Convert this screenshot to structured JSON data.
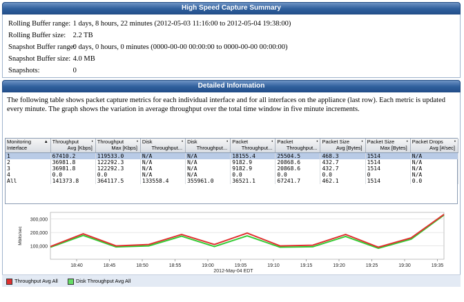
{
  "summary": {
    "title": "High Speed Capture Summary",
    "rows": [
      {
        "label": "Rolling Buffer range:",
        "value": "1 days, 8 hours, 22 minutes  (2012-05-03 11:16:00 to 2012-05-04 19:38:00)"
      },
      {
        "label": "Rolling Buffer size:",
        "value": "2.2 TB"
      },
      {
        "label": "Snapshot Buffer range:",
        "value": "0 days, 0 hours, 0 minutes   (0000-00-00 00:00:00 to 0000-00-00 00:00:00)"
      },
      {
        "label": "Snapshot Buffer size:",
        "value": "4.0 MB"
      },
      {
        "label": "Snapshots:",
        "value": "0"
      }
    ]
  },
  "detail": {
    "title": "Detailed Information",
    "description": "The following table shows packet capture metrics for each individual interface and for all interfaces on the appliance (last row). Each metric is updated every minute. The graph shows the variation in average throughput over the total time window in five minute increments."
  },
  "table": {
    "columns": [
      {
        "line1": "Monitoring",
        "line2": "Interface",
        "sort": "▲"
      },
      {
        "line1": "Throughput",
        "line2": "Avg [Kbps]",
        "sort": "•"
      },
      {
        "line1": "Throughput",
        "line2": "Max [Kbps]",
        "sort": "•"
      },
      {
        "line1": "Disk",
        "line2": "Throughput...",
        "sort": "•"
      },
      {
        "line1": "Disk",
        "line2": "Throughput...",
        "sort": "•"
      },
      {
        "line1": "Packet",
        "line2": "Throughput...",
        "sort": "•"
      },
      {
        "line1": "Packet",
        "line2": "Throughput...",
        "sort": "•"
      },
      {
        "line1": "Packet Size",
        "line2": "Avg [Bytes]",
        "sort": "•"
      },
      {
        "line1": "Packet Size",
        "line2": "Max [Bytes]",
        "sort": "•"
      },
      {
        "line1": "Packet Drops",
        "line2": "Avg [#/sec]",
        "sort": "•"
      }
    ],
    "rows": [
      [
        "1",
        "67410.2",
        "119533.0",
        "N/A",
        "N/A",
        "18155.4",
        "25504.5",
        "468.3",
        "1514",
        "N/A"
      ],
      [
        "2",
        "36981.8",
        "122292.3",
        "N/A",
        "N/A",
        "9182.9",
        "20868.6",
        "432.7",
        "1514",
        "N/A"
      ],
      [
        "3",
        "36981.8",
        "122292.3",
        "N/A",
        "N/A",
        "9182.9",
        "20868.6",
        "432.7",
        "1514",
        "N/A"
      ],
      [
        "4",
        "0.0",
        "0.0",
        "N/A",
        "N/A",
        "0.0",
        "0.0",
        "0.0",
        "0",
        "N/A"
      ],
      [
        "All",
        "141373.8",
        "364117.5",
        "133558.4",
        "355961.0",
        "36521.1",
        "67241.7",
        "462.1",
        "1514",
        "0.0"
      ]
    ]
  },
  "chart_data": {
    "type": "line",
    "ylabel": "Mbits/sec",
    "xlabel": "2012-May-04 EDT",
    "x_ticks": [
      "18:40",
      "18:45",
      "18:50",
      "18:55",
      "19:00",
      "19:05",
      "19:10",
      "19:15",
      "19:20",
      "19:25",
      "19:30",
      "19:35"
    ],
    "y_ticks": [
      "100,000",
      "200,000",
      "300,000"
    ],
    "ylim": [
      0,
      350000
    ],
    "x": [
      "18:36",
      "18:41",
      "18:46",
      "18:51",
      "18:56",
      "19:01",
      "19:06",
      "19:11",
      "19:16",
      "19:21",
      "19:26",
      "19:31",
      "19:36"
    ],
    "series": [
      {
        "name": "Throughput Avg All",
        "color": "#e03030",
        "values": [
          95000,
          190000,
          100000,
          110000,
          185000,
          110000,
          195000,
          100000,
          105000,
          185000,
          90000,
          160000,
          335000
        ]
      },
      {
        "name": "Disk Throughput Avg All",
        "color": "#33cc33",
        "values": [
          90000,
          178000,
          92000,
          100000,
          172000,
          95000,
          175000,
          90000,
          93000,
          170000,
          82000,
          150000,
          330000
        ]
      }
    ],
    "grid": true,
    "legend_position": "bottom-left"
  }
}
